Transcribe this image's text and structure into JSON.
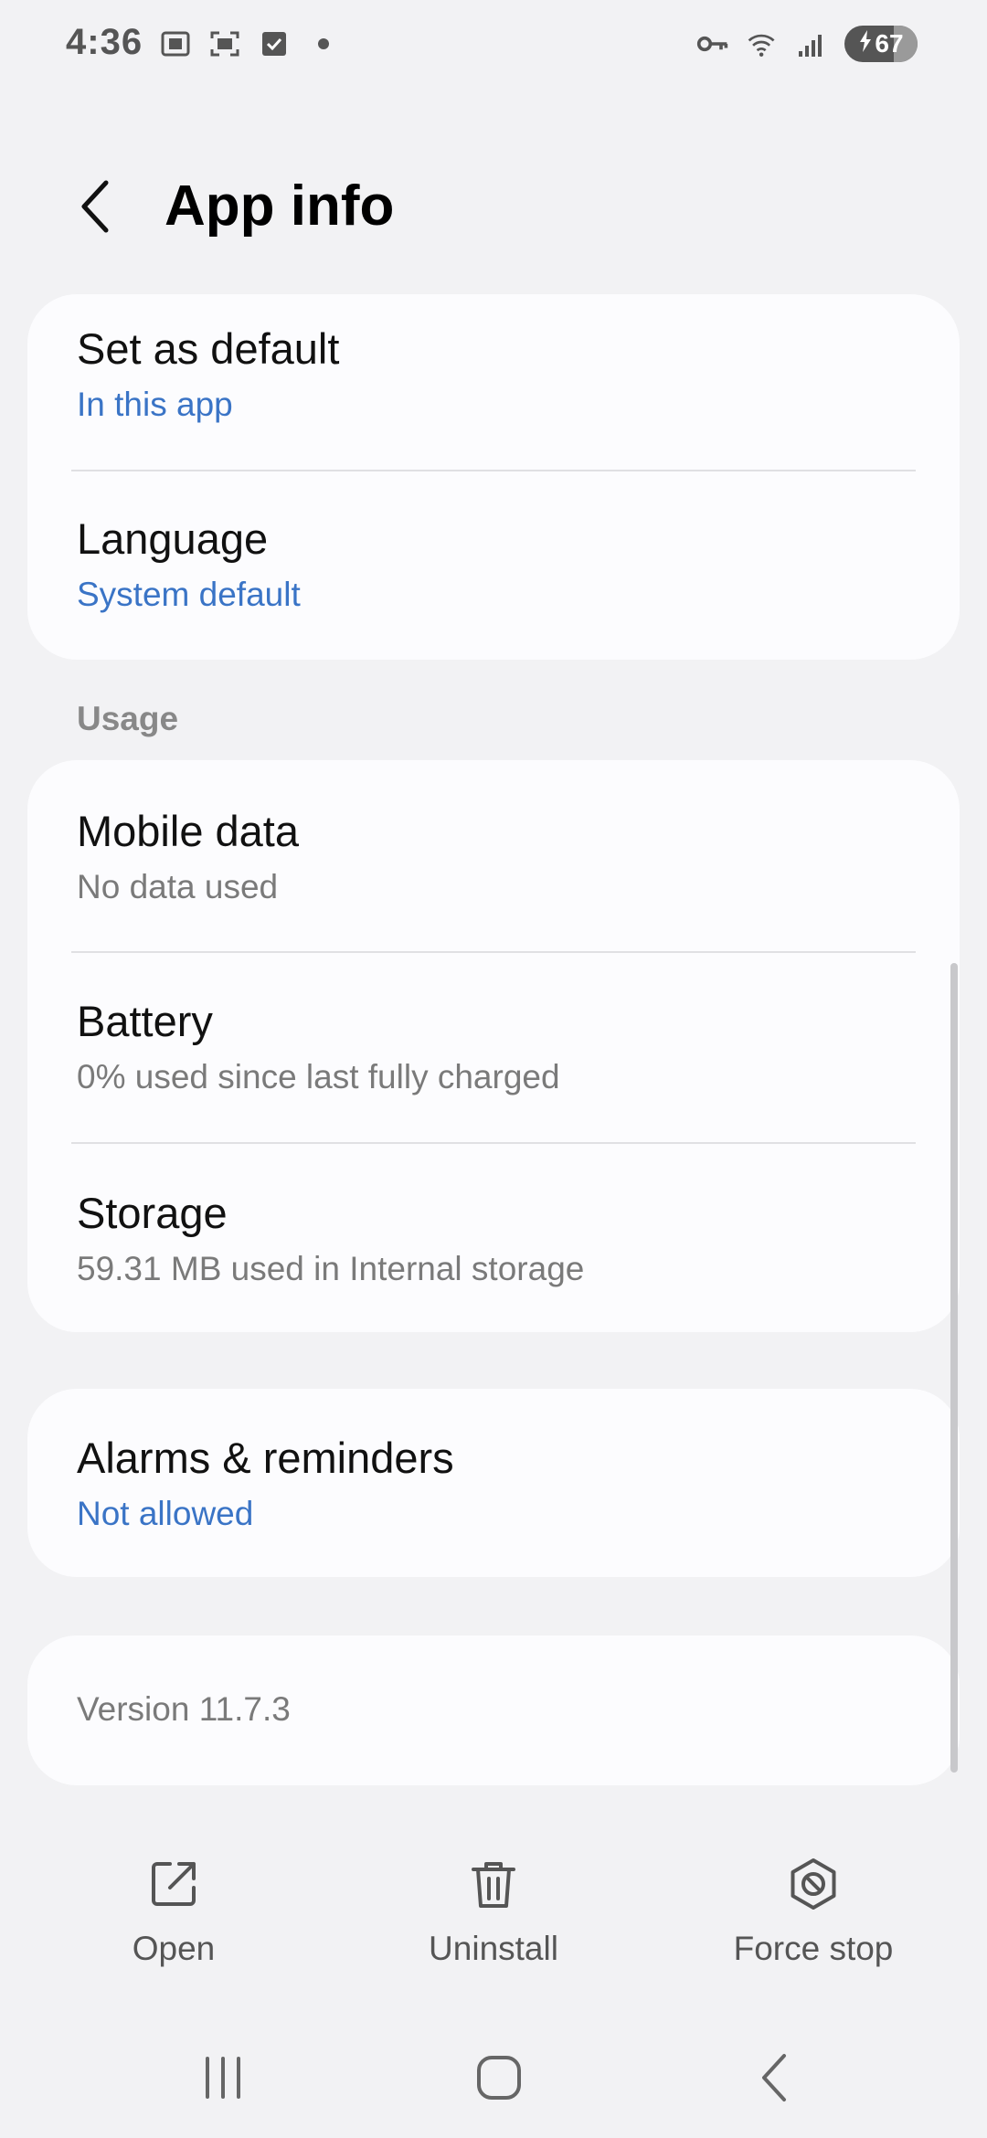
{
  "status_bar": {
    "time": "4:36",
    "left_icons": [
      "screenshot-icon",
      "scan-icon",
      "checkbox-icon",
      "dot-icon"
    ],
    "right_icons": [
      "vpn-key-icon",
      "wifi-icon",
      "signal-icon"
    ],
    "battery": "67",
    "battery_level": 0.67
  },
  "header": {
    "title": "App info"
  },
  "card_defaults": {
    "items": [
      {
        "title": "Set as default",
        "subtitle": "In this app"
      },
      {
        "title": "Language",
        "subtitle": "System default"
      }
    ]
  },
  "usage": {
    "section_label": "Usage",
    "items": [
      {
        "title": "Mobile data",
        "subtitle": "No data used"
      },
      {
        "title": "Battery",
        "subtitle": "0% used since last fully charged"
      },
      {
        "title": "Storage",
        "subtitle": "59.31 MB used in Internal storage"
      }
    ]
  },
  "alarms": {
    "title": "Alarms & reminders",
    "subtitle": "Not allowed"
  },
  "version": {
    "text": "Version 11.7.3"
  },
  "actions": {
    "open": "Open",
    "uninstall": "Uninstall",
    "force_stop": "Force stop"
  },
  "colors": {
    "background": "#f2f2f4",
    "card": "#fcfcfe",
    "accent_blue": "#3a74c6",
    "secondary_text": "#7a7a7a"
  }
}
